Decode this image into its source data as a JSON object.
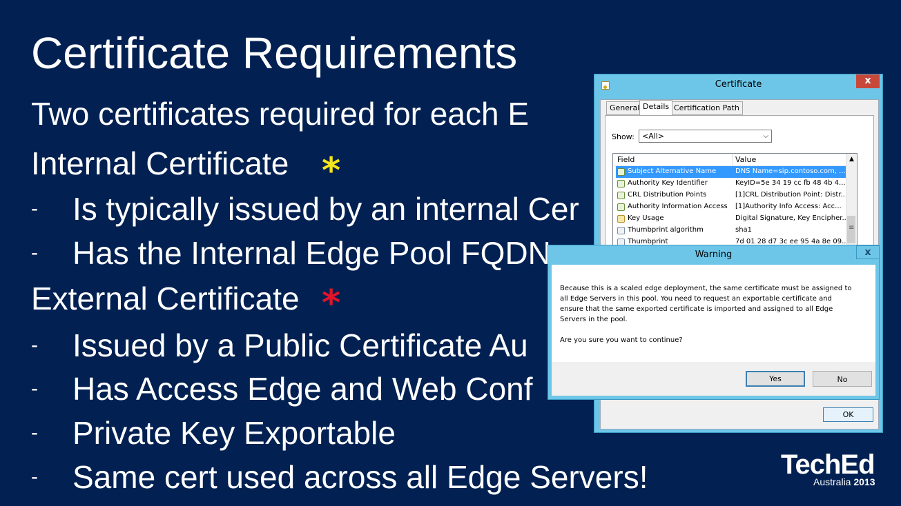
{
  "slide": {
    "title": "Certificate Requirements",
    "intro": "Two certificates required for each E",
    "internal_heading": "Internal Certificate",
    "internal_bullets": [
      "Is typically issued by an internal Cer",
      "Has the Internal Edge Pool FQDN"
    ],
    "external_heading": "External Certificate",
    "external_bullets": [
      "Issued by a Public Certificate Au",
      "Has Access Edge and Web Conf",
      "Private Key Exportable",
      "Same cert used across all Edge Servers!"
    ],
    "bullet_dash": "-",
    "star_symbol": "*",
    "colors": {
      "background": "#022152",
      "internal_star": "#f5e51a",
      "external_star": "#e3132a"
    }
  },
  "cert_window": {
    "title": "Certificate",
    "close_glyph": "x",
    "tabs": [
      "General",
      "Details",
      "Certification Path"
    ],
    "active_tab": "Details",
    "show_label": "Show:",
    "show_value": "<All>",
    "columns": [
      "Field",
      "Value"
    ],
    "rows": [
      {
        "field": "Subject Alternative Name",
        "value": "DNS Name=sip.contoso.com, ...",
        "icon": "cert-extension-icon",
        "selected": true
      },
      {
        "field": "Authority Key Identifier",
        "value": "KeyID=5e 34 19 cc fb 48 4b 4...",
        "icon": "cert-extension-icon"
      },
      {
        "field": "CRL Distribution Points",
        "value": "[1]CRL Distribution Point: Distr...",
        "icon": "cert-extension-icon"
      },
      {
        "field": "Authority Information Access",
        "value": "[1]Authority Info Access: Acc...",
        "icon": "cert-extension-icon"
      },
      {
        "field": "Key Usage",
        "value": "Digital Signature, Key Encipher...",
        "icon": "key-usage-icon"
      },
      {
        "field": "Thumbprint algorithm",
        "value": "sha1",
        "icon": "property-icon"
      },
      {
        "field": "Thumbprint",
        "value": "7d 01 28 d7 3c ee 95 4a 8e 09...",
        "icon": "property-icon"
      }
    ],
    "ok_label": "OK"
  },
  "warning_dialog": {
    "title": "Warning",
    "close_glyph": "x",
    "message": "Because this is a scaled edge deployment, the same certificate must be assigned to all Edge Servers in this pool. You need to request an exportable certificate and ensure that the same exported certificate is imported and assigned to all Edge Servers in the pool.",
    "question": "Are you sure you want to continue?",
    "yes_label": "Yes",
    "no_label": "No"
  },
  "logo": {
    "brand": "TechEd",
    "location": "Australia",
    "year": "2013"
  }
}
